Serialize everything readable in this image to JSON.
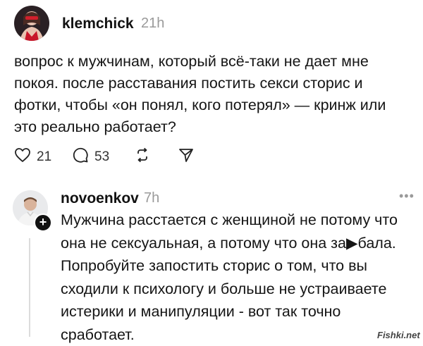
{
  "post": {
    "username": "klemchick",
    "time": "21h",
    "text": "вопрос к мужчинам, который всё-таки не дает мне\nпокоя. после расставания постить секси сторис и\nфотки, чтобы «он понял, кого потерял» — кринж или\nэто реально работает?",
    "likes": "21",
    "comments": "53",
    "icons": [
      "heart-icon",
      "comment-icon",
      "repost-icon",
      "share-icon"
    ]
  },
  "reply": {
    "username": "novoenkov",
    "time": "7h",
    "more": "•••",
    "text": "Мужчина расстается с женщиной не потому что\nона не сексуальная, а потому что она за▶бала.\nПопробуйте запостить сторис о том, что вы\nсходили к психологу и больше не устраиваете\nистерики и манипуляции -  вот так точно\nсработает.",
    "badge": "+"
  },
  "watermark": "Fishki.net",
  "colors": {
    "text": "#151515",
    "muted": "#9a9a9a",
    "avatar_red": "#c8162a"
  }
}
